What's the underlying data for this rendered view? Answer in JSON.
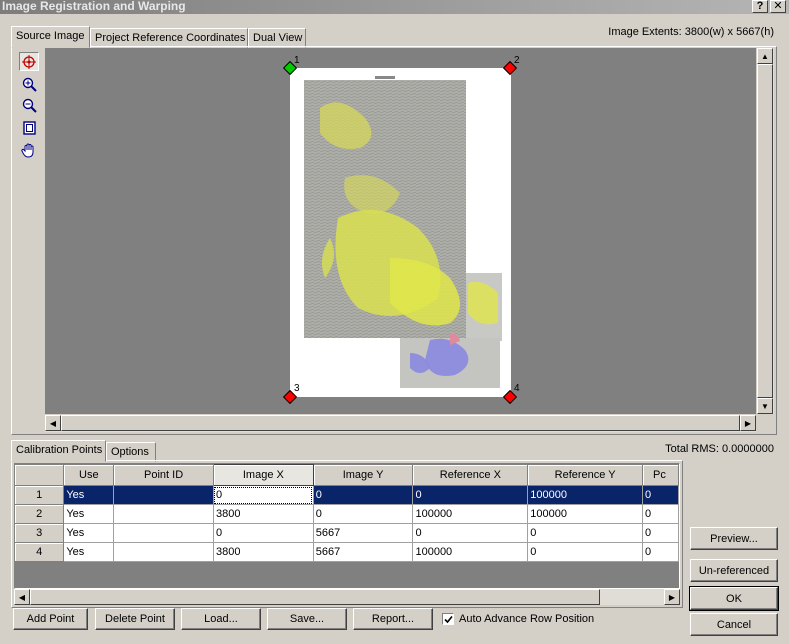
{
  "window": {
    "title": "Image Registration and Warping",
    "help_btn": "?",
    "close_btn": "✕"
  },
  "tabs": [
    {
      "label": "Source Image",
      "active": true
    },
    {
      "label": "Project Reference Coordinates",
      "active": false
    },
    {
      "label": "Dual View",
      "active": false
    }
  ],
  "image_extents": "Image Extents: 3800(w) x 5667(h)",
  "tools": [
    "target-icon",
    "zoom-in-icon",
    "zoom-out-icon",
    "fit-page-icon",
    "hand-pan-icon"
  ],
  "markers": [
    {
      "label": "1",
      "color": "#00cc00"
    },
    {
      "label": "2",
      "color": "#ff0000"
    },
    {
      "label": "3",
      "color": "#ff0000"
    },
    {
      "label": "4",
      "color": "#ff0000"
    }
  ],
  "bottom_tabs": [
    {
      "label": "Calibration Points",
      "active": true
    },
    {
      "label": "Options",
      "active": false
    }
  ],
  "total_rms": "Total RMS: 0.0000000",
  "grid": {
    "columns": [
      "",
      "Use",
      "Point ID",
      "Image X",
      "Image Y",
      "Reference X",
      "Reference Y",
      "Pc"
    ],
    "rows": [
      {
        "num": "1",
        "use": "Yes",
        "point_id": "",
        "image_x": "0",
        "image_y": "0",
        "ref_x": "0",
        "ref_y": "100000",
        "pc": "0"
      },
      {
        "num": "2",
        "use": "Yes",
        "point_id": "",
        "image_x": "3800",
        "image_y": "0",
        "ref_x": "100000",
        "ref_y": "100000",
        "pc": "0"
      },
      {
        "num": "3",
        "use": "Yes",
        "point_id": "",
        "image_x": "0",
        "image_y": "5667",
        "ref_x": "0",
        "ref_y": "0",
        "pc": "0"
      },
      {
        "num": "4",
        "use": "Yes",
        "point_id": "",
        "image_x": "3800",
        "image_y": "5667",
        "ref_x": "100000",
        "ref_y": "0",
        "pc": "0"
      }
    ]
  },
  "buttons": {
    "add_point": "Add Point",
    "delete_point": "Delete Point",
    "load": "Load...",
    "save": "Save...",
    "report": "Report...",
    "preview": "Preview...",
    "unreferenced": "Un-referenced",
    "ok": "OK",
    "cancel": "Cancel"
  },
  "auto_advance": {
    "label": "Auto Advance Row Position",
    "checked": true
  },
  "colors": {
    "selection": "#0a246a",
    "viewport": "#808080",
    "face": "#d4d0c8"
  }
}
